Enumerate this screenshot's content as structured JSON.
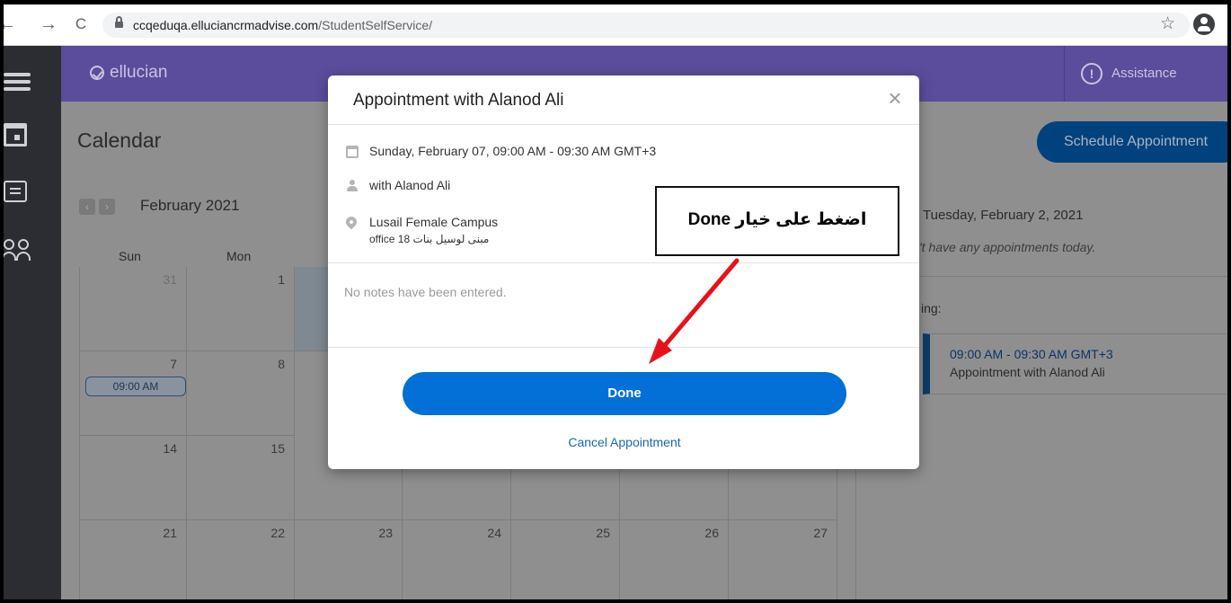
{
  "browser": {
    "back": "←",
    "forward": "→",
    "reload": "C",
    "url_host": "ccqeduqa.elluciancrmadvise.com",
    "url_path": "/StudentSelfService/",
    "star": "☆"
  },
  "header": {
    "logo": "ellucian",
    "assistance": "Assistance",
    "assist_symbol": "!"
  },
  "page": {
    "title": "Calendar",
    "schedule_button": "Schedule Appointment",
    "prev": "‹",
    "next": "›",
    "month": "February 2021"
  },
  "calendar": {
    "days_of_week": [
      "Sun",
      "Mon"
    ],
    "rows": [
      [
        "31",
        "1"
      ],
      [
        "7",
        "8"
      ],
      [
        "14",
        "15"
      ],
      [
        "21",
        "22",
        "23",
        "24",
        "25",
        "26",
        "27"
      ]
    ],
    "appointment_chip": "09:00 AM"
  },
  "side_panel": {
    "date": "Tuesday, February 2, 2021",
    "no_appointments": "'t have any appointments today.",
    "upcoming_label": "ing:",
    "item_time": "09:00 AM - 09:30 AM GMT+3",
    "item_title": "Appointment with Alanod Ali"
  },
  "modal": {
    "title": "Appointment with Alanod Ali",
    "close": "×",
    "datetime": "Sunday, February 07, 09:00 AM - 09:30 AM GMT+3",
    "with": "with Alanod Ali",
    "location": "Lusail Female Campus",
    "office": "office 18 مبنى لوسيل بنات",
    "notes": "No notes have been entered.",
    "done_button": "Done",
    "cancel_link": "Cancel Appointment"
  },
  "annotation": {
    "text": "اضغط على خيار Done",
    "arrow_color": "#e8111a"
  },
  "colors": {
    "header_purple": "#5b4c9c",
    "done_blue": "#0270d7",
    "link_blue": "#1569b8",
    "sidebar_dark": "#2c2d33"
  }
}
